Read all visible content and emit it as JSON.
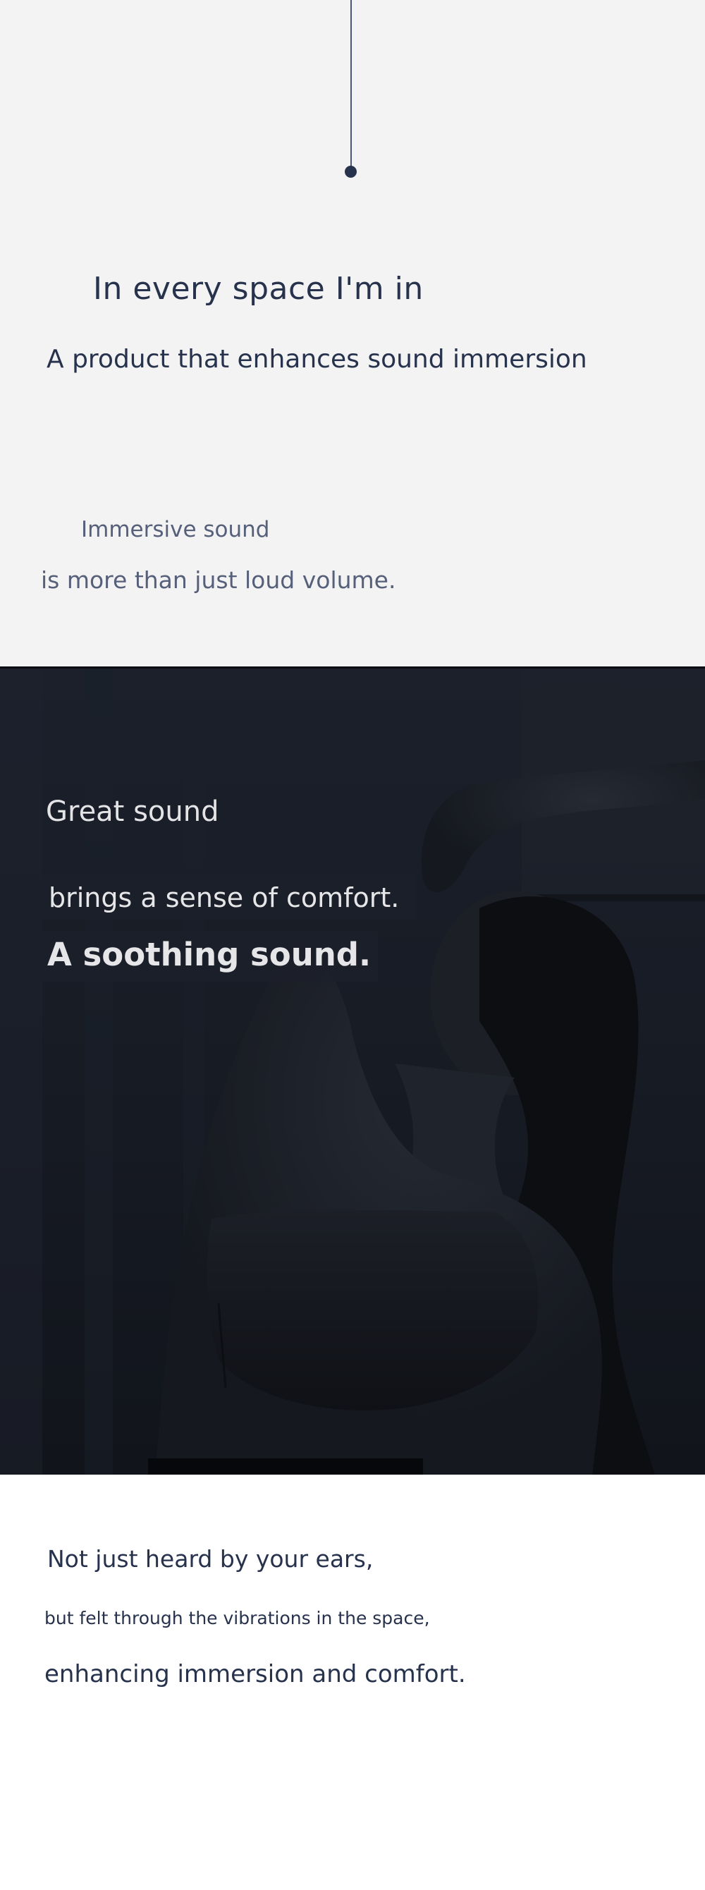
{
  "intro": {
    "heading": "In every space I'm in",
    "subheading": "A product that enhances sound immersion",
    "tagline_line1": "Immersive sound",
    "tagline_line2": "is more than just loud volume."
  },
  "hero": {
    "line1": "Great sound",
    "line2": "brings a sense of comfort.",
    "line3": "A soothing sound.",
    "image_subject": "woman-stretching-photo"
  },
  "closing": {
    "line1": "Not just heard by your ears,",
    "line2": "but felt through the vibrations in the space,",
    "line3": "enhancing immersion and comfort."
  },
  "colors": {
    "primary_text": "#27324d",
    "muted_text": "#56607a",
    "light_bg": "#f3f3f3",
    "dark_bg": "#151922",
    "hero_text": "#e6e6e8"
  }
}
